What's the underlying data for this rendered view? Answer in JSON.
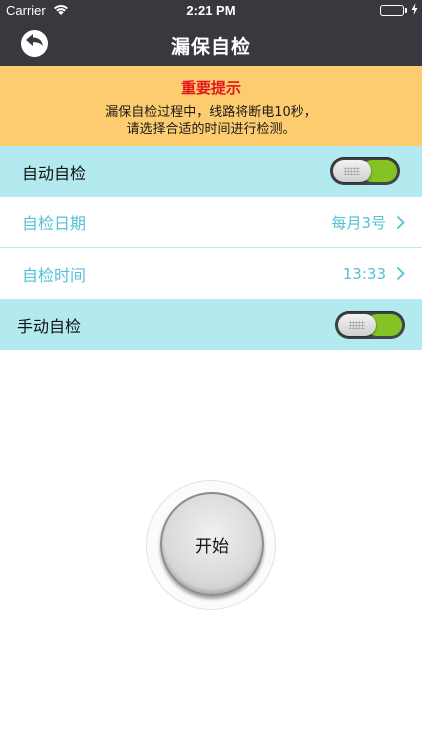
{
  "status_bar": {
    "carrier": "Carrier",
    "time": "2:21 PM",
    "wifi_icon": "wifi-icon",
    "battery_icon": "battery-icon",
    "charging_icon": "charging-bolt-icon",
    "battery_level": 1.0,
    "battery_color": "#4cd964"
  },
  "nav": {
    "title": "漏保自检",
    "back_icon": "back-arrow-icon",
    "background": "#37393f"
  },
  "notice": {
    "title": "重要提示",
    "line1": "漏保自检过程中，线路将断电10秒，",
    "line2": "请选择合适的时间进行检测。",
    "background": "#fdcc6f",
    "title_color": "#e3171b"
  },
  "settings": {
    "auto_check": {
      "label": "自动自检",
      "toggle_on": true
    },
    "check_date": {
      "label": "自检日期",
      "value": "每月3号"
    },
    "check_time": {
      "label": "自检时间",
      "value": "13:33"
    },
    "manual_check": {
      "label": "手动自检",
      "toggle_on": true
    },
    "accent_color": "#53c1d8",
    "row_background": "#b3eaf0",
    "toggle_on_color": "#84c326"
  },
  "start_button": {
    "label": "开始"
  }
}
